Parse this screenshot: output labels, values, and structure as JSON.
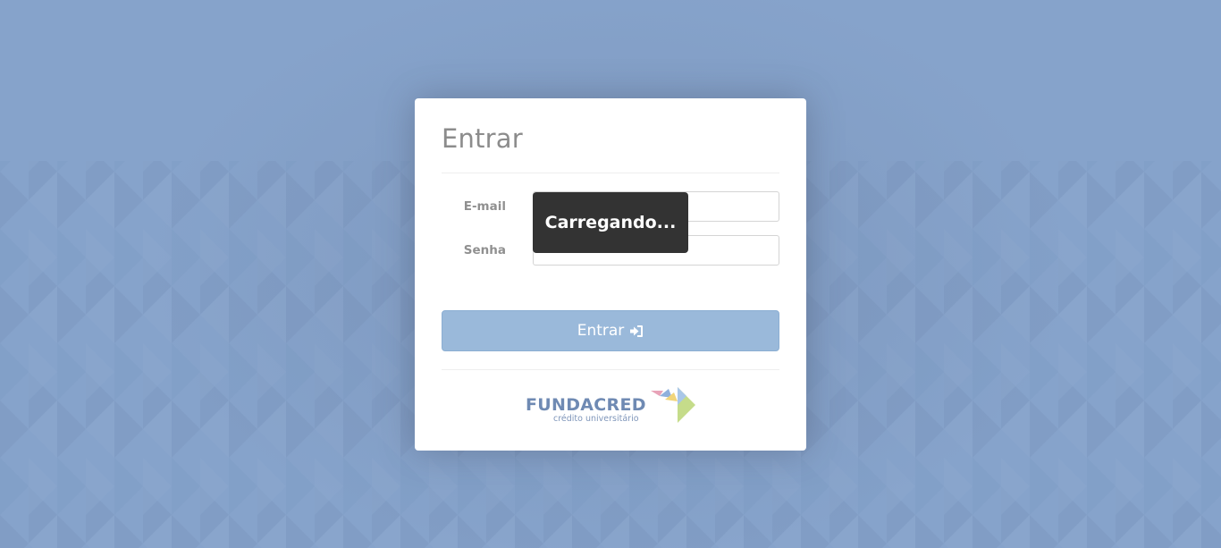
{
  "login": {
    "title": "Entrar",
    "email_label": "E-mail",
    "email_value": "",
    "password_label": "Senha",
    "password_value": "",
    "submit_label": "Entrar",
    "submit_icon": "sign-in-icon"
  },
  "brand": {
    "name": "FUNDACRED",
    "tagline": "crédito universitário",
    "colors": {
      "name": "#6f8ab3",
      "mark_pink": "#e8a3b8",
      "mark_blue": "#8fb0dc",
      "mark_yellow": "#f1d57a",
      "mark_green": "#c5dc8a"
    }
  },
  "loading": {
    "text": "Carregando..."
  },
  "theme": {
    "background": "#86a3cb",
    "button_bg": "#9ab9da",
    "overlay_bg": "#333333"
  }
}
